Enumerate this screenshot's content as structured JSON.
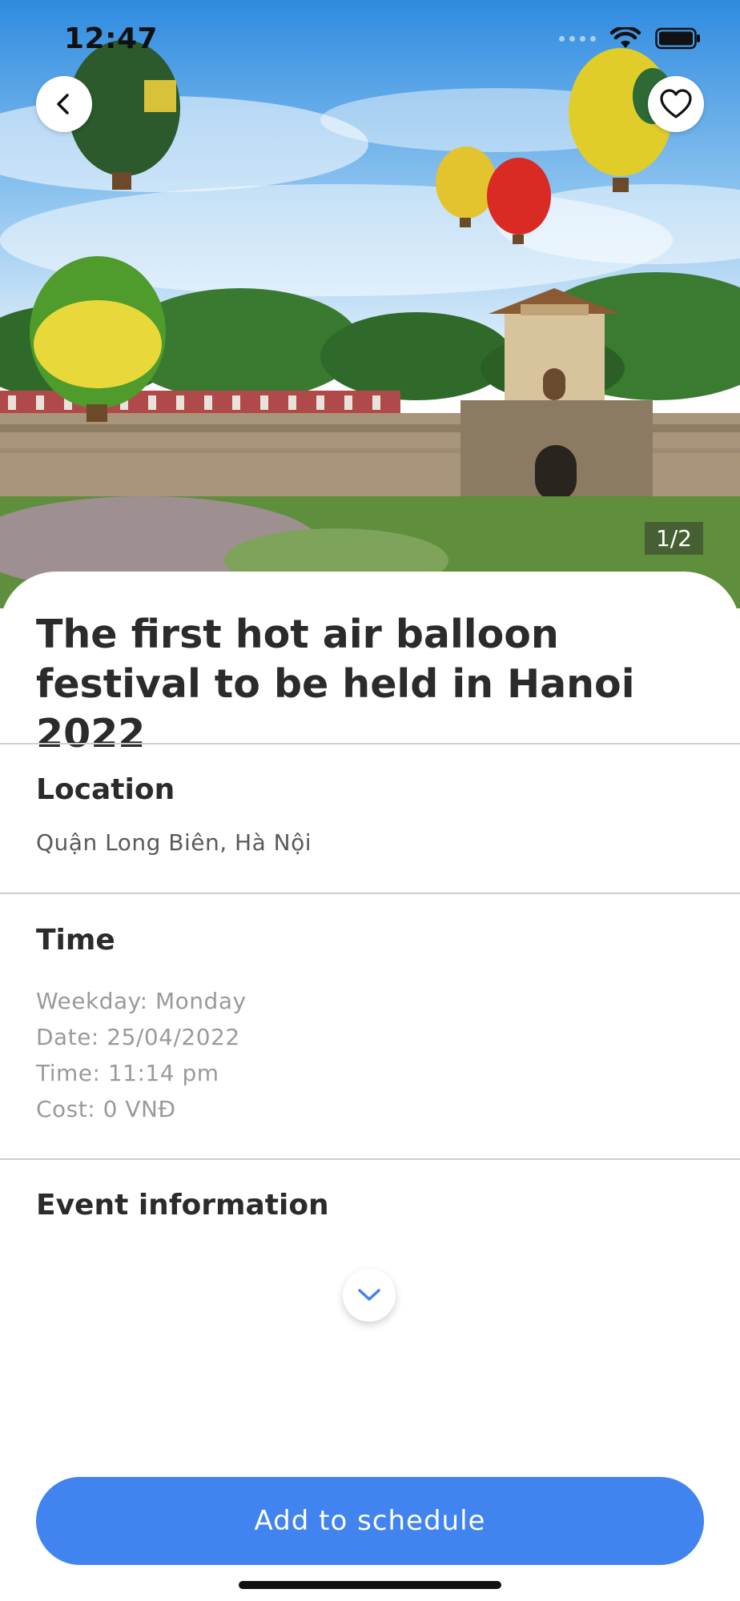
{
  "status_bar": {
    "time": "12:47"
  },
  "hero": {
    "image_counter": "1/2"
  },
  "event": {
    "title": "The first hot air balloon festival to be held in Hanoi 2022"
  },
  "location": {
    "heading": "Location",
    "value": "Quận Long Biên, Hà Nội"
  },
  "time": {
    "heading": "Time",
    "weekday": "Weekday: Monday",
    "date": "Date: 25/04/2022",
    "time": "Time: 11:14 pm",
    "cost": "Cost: 0 VNĐ"
  },
  "event_info": {
    "heading": "Event information"
  },
  "actions": {
    "add_to_schedule": "Add to schedule"
  },
  "colors": {
    "primary": "#4184f0",
    "divider": "#cfcfcf",
    "muted_text": "#9a9a9a"
  },
  "icons": {
    "back": "chevron-left-icon",
    "favorite": "heart-outline-icon",
    "expand": "chevron-down-icon",
    "wifi": "wifi-icon",
    "battery": "battery-icon",
    "signal": "signal-icon"
  }
}
